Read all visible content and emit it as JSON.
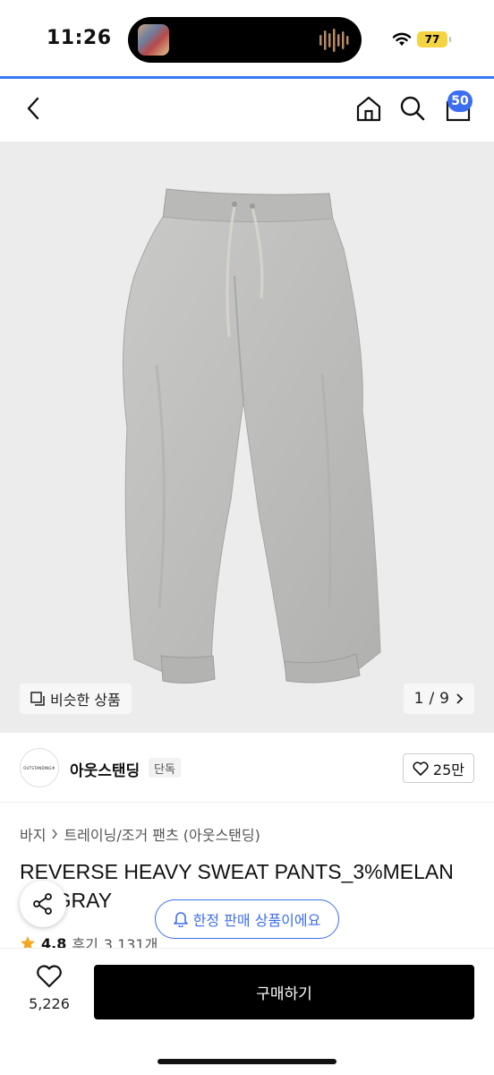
{
  "status_bar": {
    "time": "11:26",
    "battery": "77",
    "wifi_icon": "wifi-icon",
    "accent": "#3a78f2"
  },
  "nav": {
    "back_icon": "chevron-left-icon",
    "home_icon": "home-icon",
    "search_icon": "search-icon",
    "cart_icon": "shopping-bag-icon",
    "cart_count": "50"
  },
  "gallery": {
    "similar_label": "비슷한 상품",
    "page_current": "1",
    "page_total": "9",
    "page_separator": "/"
  },
  "brand": {
    "logo_text": "OUTSTANDING®",
    "name": "아웃스탠딩",
    "tag": "단독",
    "likes": "25만"
  },
  "product": {
    "breadcrumb": [
      "바지",
      "트레이닝/조거 팬츠 (아웃스탠딩)"
    ],
    "title": "REVERSE HEAVY SWEAT PANTS_3%MELAN GE GRAY",
    "rating": "4.8",
    "review_label": "후기",
    "review_count": "3,131개"
  },
  "floating": {
    "limited_label": "한정 판매 상품이에요"
  },
  "bottom": {
    "wish_count": "5,226",
    "buy_label": "구매하기"
  },
  "colors": {
    "primary_blue": "#3d6ef0",
    "buy_button": "#000000",
    "star": "#f5a623"
  }
}
